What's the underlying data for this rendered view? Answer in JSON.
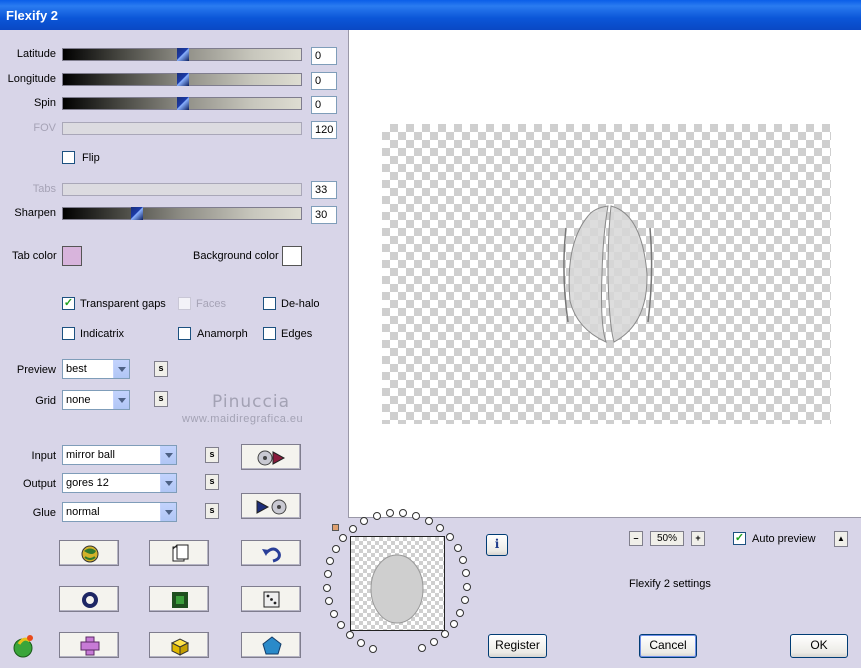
{
  "window": {
    "title": "Flexify 2"
  },
  "sliders": [
    {
      "label": "Latitude",
      "value": "0",
      "level": 0.5,
      "enabled": true
    },
    {
      "label": "Longitude",
      "value": "0",
      "level": 0.5,
      "enabled": true
    },
    {
      "label": "Spin",
      "value": "0",
      "level": 0.5,
      "enabled": true
    },
    {
      "label": "FOV",
      "value": "120",
      "level": 0,
      "enabled": false
    },
    {
      "label": "Tabs",
      "value": "33",
      "level": 0,
      "enabled": false
    },
    {
      "label": "Sharpen",
      "value": "30",
      "level": 0.3,
      "enabled": true
    }
  ],
  "flip": {
    "label": "Flip",
    "checked": false
  },
  "colors": {
    "tab_color_label": "Tab color",
    "tab_color": "#d8b4dc",
    "background_color_label": "Background color",
    "background_color": "#ffffff"
  },
  "options": {
    "transparent_gaps": {
      "label": "Transparent gaps",
      "checked": true
    },
    "faces": {
      "label": "Faces",
      "checked": false
    },
    "de_halo": {
      "label": "De-halo",
      "checked": false
    },
    "indicatrix": {
      "label": "Indicatrix",
      "checked": false
    },
    "anamorph": {
      "label": "Anamorph",
      "checked": false
    },
    "edges": {
      "label": "Edges",
      "checked": false
    }
  },
  "selects": {
    "preview": {
      "label": "Preview",
      "value": "best"
    },
    "grid": {
      "label": "Grid",
      "value": "none"
    },
    "input": {
      "label": "Input",
      "value": "mirror ball"
    },
    "output": {
      "label": "Output",
      "value": "gores 12"
    },
    "glue": {
      "label": "Glue",
      "value": "normal"
    }
  },
  "small_button_label": "s",
  "watermark": {
    "name": "Pinuccia",
    "url": "www.maidiregrafica.eu"
  },
  "zoom": {
    "minus": "–",
    "value": "50%",
    "plus": "+"
  },
  "auto_preview": {
    "label": "Auto preview",
    "checked": true
  },
  "scroll_up": "▲",
  "settings_name": "Flexify 2 settings",
  "info_icon": "i",
  "buttons": {
    "register": "Register",
    "cancel": "Cancel",
    "ok": "OK"
  },
  "accent_colors": {
    "title_bar": "#0a5ee8",
    "checkmark": "#21a121",
    "slider_thumb": "#1b3aa8"
  }
}
